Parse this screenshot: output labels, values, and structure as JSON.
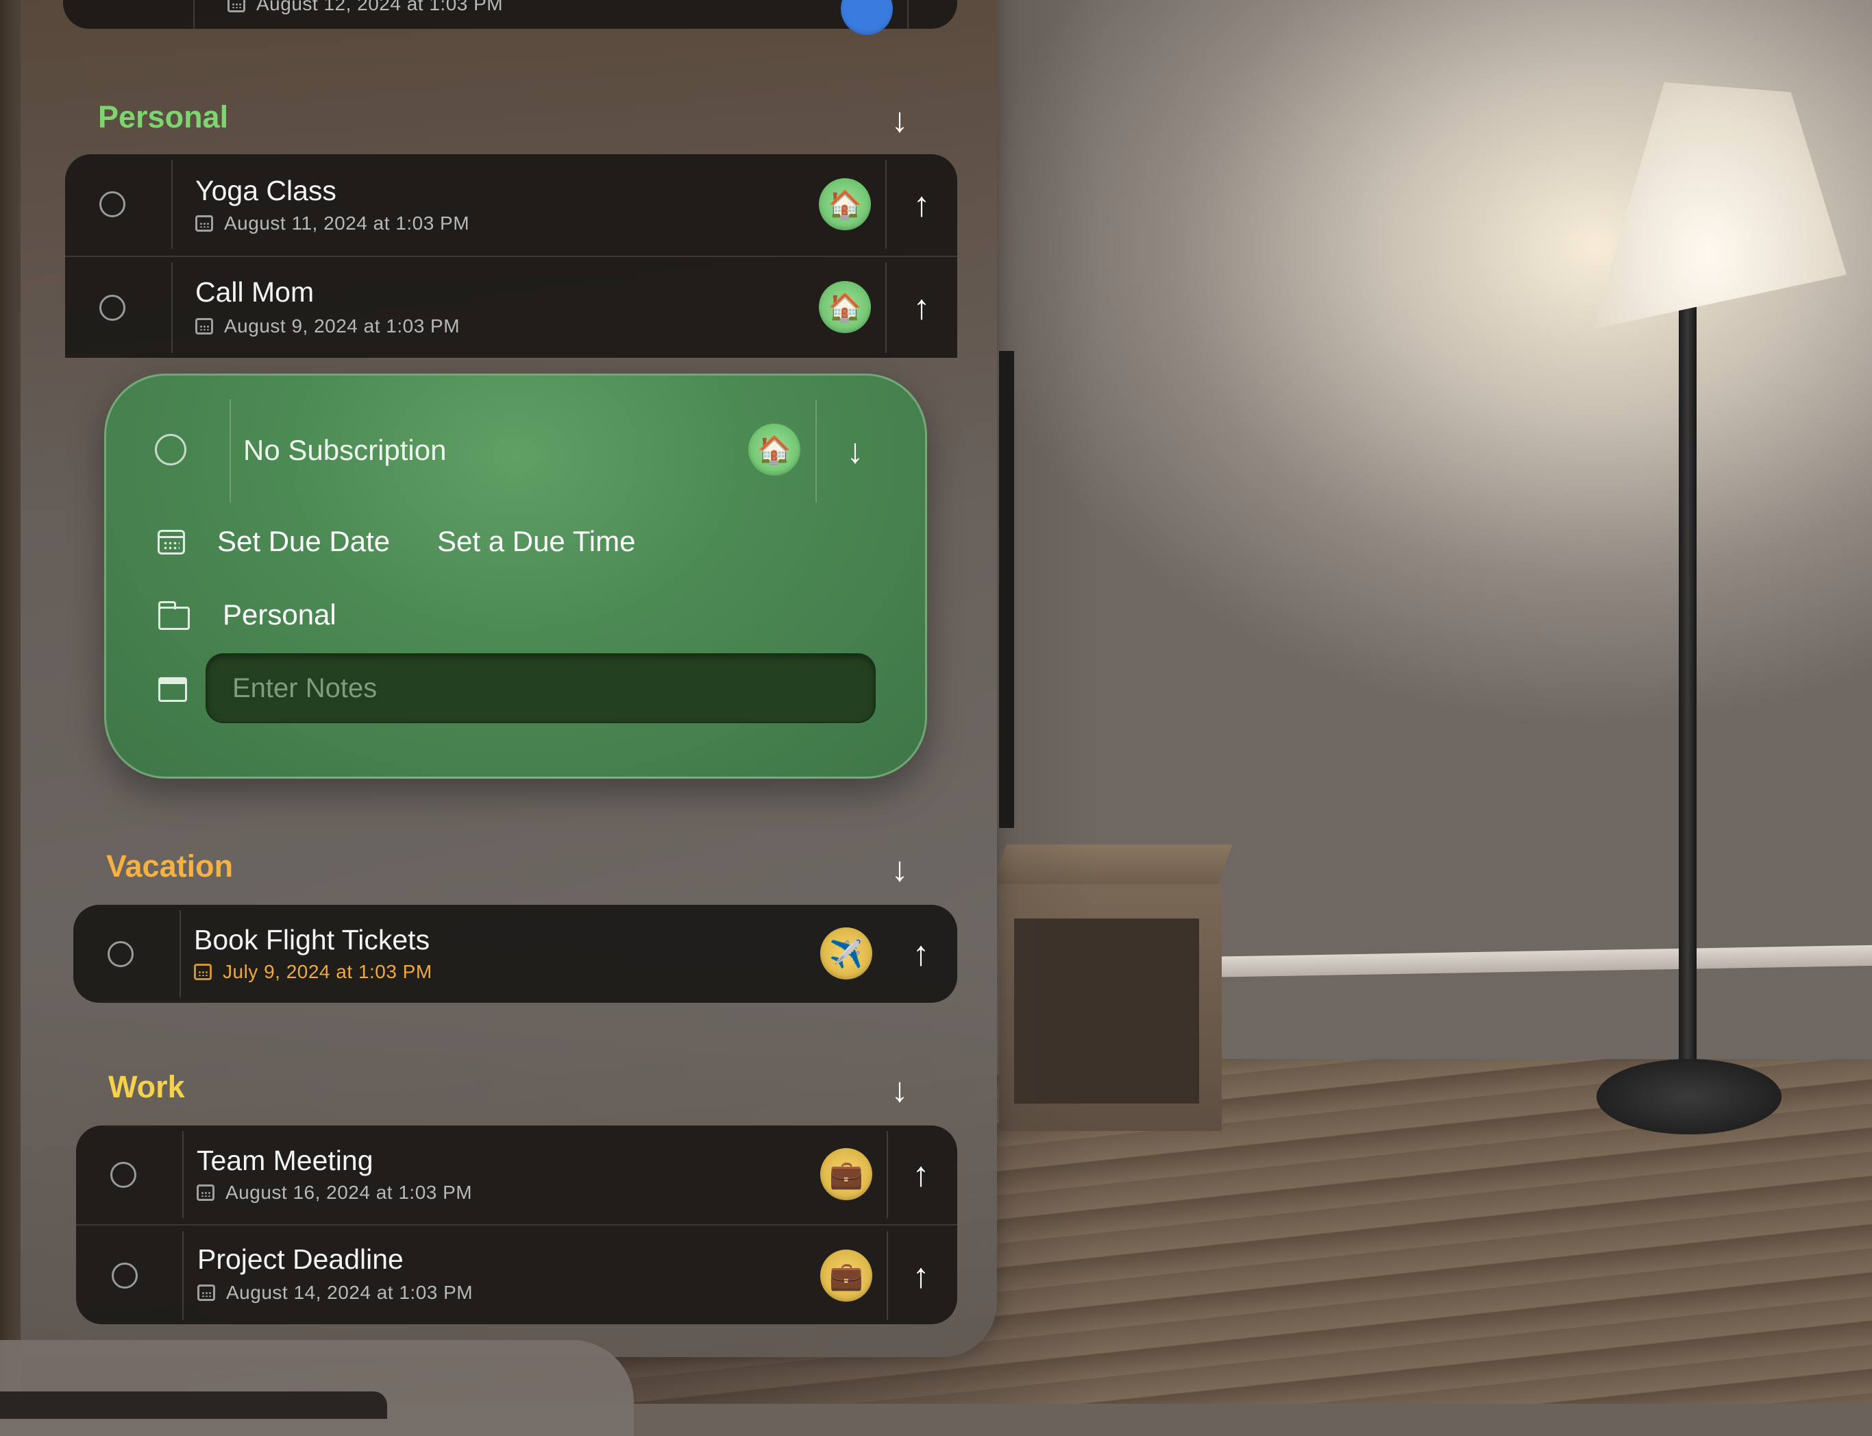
{
  "top_item": {
    "date": "August 12, 2024 at 1:03 PM"
  },
  "sections": {
    "personal": {
      "title": "Personal",
      "color": "#7ed56f",
      "toggle_icon": "arrow-down-icon",
      "items": [
        {
          "title": "Yoga Class",
          "date": "August 11, 2024 at 1:03 PM",
          "badge_icon": "house-emoji",
          "emoji": "🏠"
        },
        {
          "title": "Call Mom",
          "date": "August 9, 2024 at 1:03 PM",
          "badge_icon": "house-emoji",
          "emoji": "🏠"
        }
      ]
    },
    "vacation": {
      "title": "Vacation",
      "color": "#f5b141",
      "toggle_icon": "arrow-down-icon",
      "items": [
        {
          "title": "Book Flight Tickets",
          "date": "July 9, 2024 at 1:03 PM",
          "badge_icon": "airplane-emoji",
          "emoji": "✈️",
          "date_color": "#f0a93a"
        }
      ]
    },
    "work": {
      "title": "Work",
      "color": "#f6d24a",
      "toggle_icon": "arrow-down-icon",
      "items": [
        {
          "title": "Team Meeting",
          "date": "August 16, 2024 at 1:03 PM",
          "badge_icon": "briefcase-emoji",
          "emoji": "💼"
        },
        {
          "title": "Project Deadline",
          "date": "August 14, 2024 at 1:03 PM",
          "badge_icon": "briefcase-emoji",
          "emoji": "💼"
        }
      ]
    }
  },
  "expanded_task": {
    "title": "No Subscription",
    "emoji": "🏠",
    "set_due_date": "Set Due Date",
    "set_due_time": "Set a Due Time",
    "category": "Personal",
    "notes_placeholder": "Enter Notes",
    "notes_value": ""
  },
  "arrows": {
    "up": "↑",
    "down": "↓"
  }
}
